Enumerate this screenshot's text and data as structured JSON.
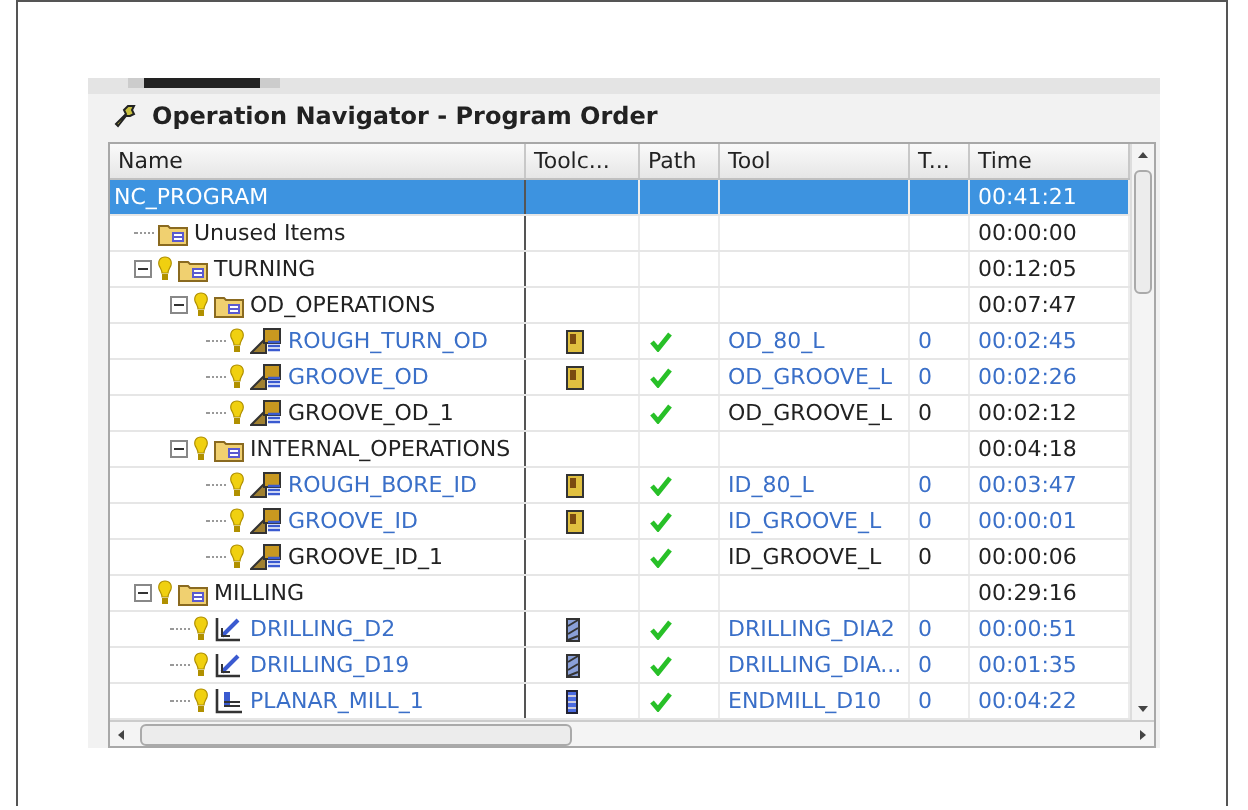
{
  "panel": {
    "title": "Operation Navigator - Program Order"
  },
  "columns": [
    "Name",
    "Toolc...",
    "Path",
    "Tool",
    "T...",
    "Time"
  ],
  "tree": [
    {
      "name": "NC_PROGRAM",
      "selected": true,
      "time": "00:41:21",
      "children": [
        {
          "name": "Unused Items",
          "kind": "group",
          "selected": false,
          "time": "00:00:00"
        },
        {
          "name": "TURNING",
          "kind": "group",
          "bulb": true,
          "expanded": true,
          "selected": false,
          "time": "00:12:05",
          "children": [
            {
              "name": "OD_OPERATIONS",
              "kind": "group",
              "bulb": true,
              "expanded": true,
              "selected": false,
              "time": "00:07:47",
              "children": [
                {
                  "name": "ROUGH_TURN_OD",
                  "kind": "turning",
                  "bulb": true,
                  "modified": true,
                  "selected": false,
                  "tool_shown": true,
                  "path_ok": true,
                  "tool": "OD_80_L",
                  "tool_number": "0",
                  "time": "00:02:45"
                },
                {
                  "name": "GROOVE_OD",
                  "kind": "turning",
                  "bulb": true,
                  "modified": true,
                  "selected": false,
                  "tool_shown": true,
                  "path_ok": true,
                  "tool": "OD_GROOVE_L",
                  "tool_number": "0",
                  "time": "00:02:26"
                },
                {
                  "name": "GROOVE_OD_1",
                  "kind": "turning",
                  "bulb": true,
                  "modified": false,
                  "selected": false,
                  "path_ok": true,
                  "tool": "OD_GROOVE_L",
                  "tool_number": "0",
                  "time": "00:02:12"
                }
              ]
            },
            {
              "name": "INTERNAL_OPERATIONS",
              "kind": "group",
              "bulb": true,
              "expanded": true,
              "selected": false,
              "time": "00:04:18",
              "children": [
                {
                  "name": "ROUGH_BORE_ID",
                  "kind": "turning",
                  "bulb": true,
                  "modified": true,
                  "selected": false,
                  "tool_shown": true,
                  "path_ok": true,
                  "tool": "ID_80_L",
                  "tool_number": "0",
                  "time": "00:03:47"
                },
                {
                  "name": "GROOVE_ID",
                  "kind": "turning",
                  "bulb": true,
                  "modified": true,
                  "selected": false,
                  "tool_shown": true,
                  "path_ok": true,
                  "tool": "ID_GROOVE_L",
                  "tool_number": "0",
                  "time": "00:00:01"
                },
                {
                  "name": "GROOVE_ID_1",
                  "kind": "turning",
                  "bulb": true,
                  "modified": false,
                  "selected": false,
                  "path_ok": true,
                  "tool": "ID_GROOVE_L",
                  "tool_number": "0",
                  "time": "00:00:06"
                }
              ]
            }
          ]
        },
        {
          "name": "MILLING",
          "kind": "group",
          "bulb": true,
          "expanded": true,
          "selected": false,
          "time": "00:29:16",
          "children": [
            {
              "name": "DRILLING_D2",
              "kind": "drilling",
              "bulb": true,
              "modified": true,
              "selected": false,
              "tool_shown": true,
              "path_ok": true,
              "tool": "DRILLING_DIA2",
              "tool_number": "0",
              "time": "00:00:51"
            },
            {
              "name": "DRILLING_D19",
              "kind": "drilling",
              "bulb": true,
              "modified": true,
              "selected": false,
              "tool_shown": true,
              "path_ok": true,
              "tool": "DRILLING_DIA...",
              "tool_number": "0",
              "time": "00:01:35"
            },
            {
              "name": "PLANAR_MILL_1",
              "kind": "planar",
              "bulb": true,
              "modified": true,
              "selected": false,
              "tool_shown": true,
              "path_ok": true,
              "tool": "ENDMILL_D10",
              "tool_number": "0",
              "time": "00:04:22"
            }
          ]
        }
      ]
    }
  ]
}
